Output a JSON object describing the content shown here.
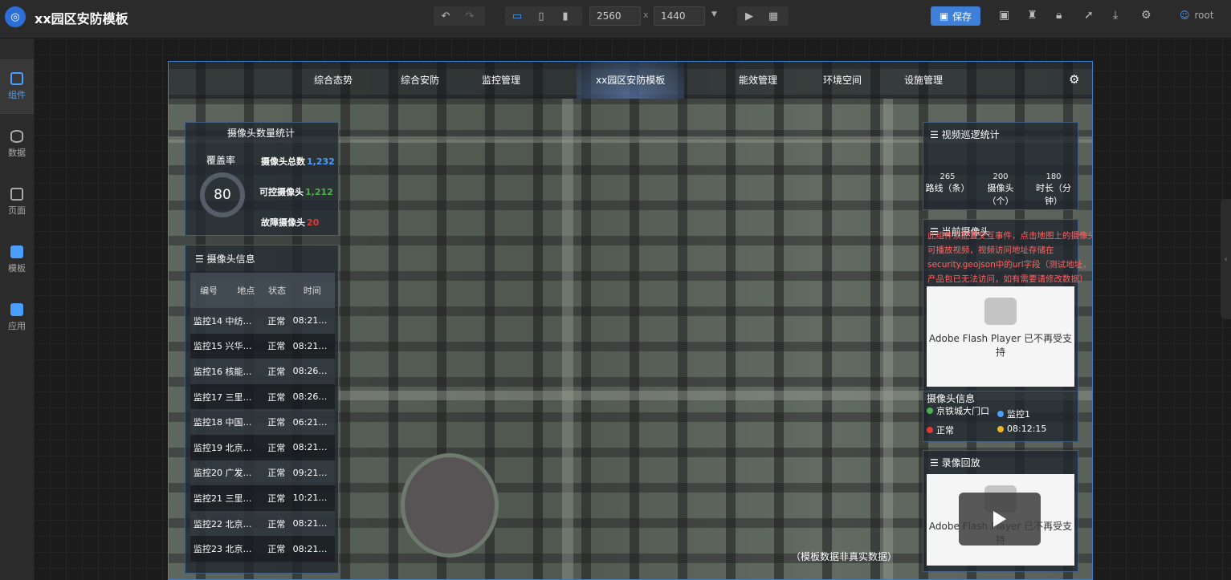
{
  "app": {
    "title": "xx园区安防模板",
    "save_label": "保存",
    "user": "root"
  },
  "toolbar": {
    "width": "2560",
    "height": "1440",
    "x_sep": "x"
  },
  "sidebar": {
    "items": [
      {
        "label": "组件"
      },
      {
        "label": "数据"
      },
      {
        "label": "页面"
      },
      {
        "label": "模板"
      },
      {
        "label": "应用"
      }
    ]
  },
  "nav": {
    "items": [
      "综合态势",
      "综合安防",
      "监控管理",
      "xx园区安防模板",
      "能效管理",
      "环境空间",
      "设施管理"
    ]
  },
  "camera_stats": {
    "title": "摄像头数量统计",
    "coverage_label": "覆盖率",
    "coverage_value": "80",
    "total_label": "摄像头总数",
    "total_value": "1,232",
    "ctrl_label": "可控摄像头",
    "ctrl_value": "1,212",
    "fault_label": "故障摄像头",
    "fault_value": "20",
    "colors": {
      "total": "#4a9eff",
      "ctrl": "#4caf50",
      "fault": "#e53935"
    }
  },
  "camera_info": {
    "title": "摄像头信息",
    "headers": [
      "编号",
      "地点",
      "状态",
      "时间"
    ],
    "rows": [
      [
        "监控14 中纺…",
        "正常",
        "08:21…"
      ],
      [
        "监控15 兴华…",
        "正常",
        "08:21…"
      ],
      [
        "监控16 核能…",
        "正常",
        "08:26…"
      ],
      [
        "监控17 三里…",
        "正常",
        "08:26…"
      ],
      [
        "监控18 中国…",
        "正常",
        "06:21…"
      ],
      [
        "监控19 北京…",
        "正常",
        "08:21…"
      ],
      [
        "监控20 广发…",
        "正常",
        "09:21…"
      ],
      [
        "监控21 三里…",
        "正常",
        "10:21…"
      ],
      [
        "监控22 北京…",
        "正常",
        "08:21…"
      ],
      [
        "监控23 北京…",
        "正常",
        "08:21…"
      ]
    ]
  },
  "patrol": {
    "title": "视频巡逻统计",
    "stats": [
      {
        "value": "265",
        "label": "路线（条）"
      },
      {
        "value": "200",
        "label": "摄像头（个）"
      },
      {
        "value": "180",
        "label": "时长（分钟）"
      }
    ]
  },
  "current_camera": {
    "title": "当前摄像头",
    "note": "此组件须配置交互事件，点击地图上的摄像头可播放视频，视频访问地址存储在security.geojson中的url字段（测试地址，产品包已无法访问，如有需要请修改数据）",
    "flash_text": "Adobe Flash Player 已不再受支持"
  },
  "cam_detail": {
    "title": "摄像头信息",
    "location": "京铁城大门口",
    "name": "监控1",
    "status": "正常",
    "time": "08:12:15"
  },
  "playback": {
    "title": "录像回放",
    "flash_text": "Adobe Flash Player 已不再受支持"
  },
  "footnote": "（模板数据非真实数据）"
}
